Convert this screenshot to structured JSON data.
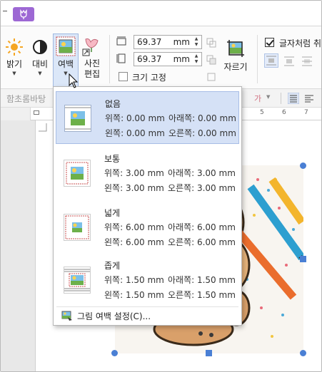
{
  "ribbon": {
    "brightness_label": "밝기",
    "contrast_label": "대비",
    "margin_label": "여백",
    "photo_edit_label": "사진\n편집",
    "photo_edit_line1": "사진",
    "photo_edit_line2": "편집",
    "width_value": "69.37",
    "height_value": "69.37",
    "unit": "mm",
    "keep_ratio_label": "크기 고정",
    "crop_label": "자르기",
    "wrap_text_label": "글자처럼 취",
    "wrap_text_checked": true,
    "keep_ratio_checked": false
  },
  "format_bar": {
    "style_name": "함초롬바탕"
  },
  "ruler": {
    "ticks": [
      "5",
      "6",
      "7"
    ]
  },
  "dropdown": {
    "options": [
      {
        "title": "없음",
        "top_label": "위쪽: 0.00 mm",
        "bottom_label": "아래쪽: 0.00 mm",
        "left_label": "왼쪽: 0.00 mm",
        "right_label": "오른쪽: 0.00 mm",
        "selected": true
      },
      {
        "title": "보통",
        "top_label": "위쪽: 3.00 mm",
        "bottom_label": "아래쪽: 3.00 mm",
        "left_label": "왼쪽: 3.00 mm",
        "right_label": "오른쪽: 3.00 mm",
        "selected": false
      },
      {
        "title": "넓게",
        "top_label": "위쪽: 6.00 mm",
        "bottom_label": "아래쪽: 6.00 mm",
        "left_label": "왼쪽: 6.00 mm",
        "right_label": "오른쪽: 6.00 mm",
        "selected": false
      },
      {
        "title": "좁게",
        "top_label": "위쪽: 1.50 mm",
        "bottom_label": "아래쪽: 1.50 mm",
        "left_label": "왼쪽: 1.50 mm",
        "right_label": "오른쪽: 1.50 mm",
        "selected": false
      }
    ],
    "footer_label": "그림 여백 설정(C)..."
  },
  "colors": {
    "context_tab": "#9d68d4",
    "selected_option": "#d5e1f6",
    "handle": "#4a7fd4"
  }
}
